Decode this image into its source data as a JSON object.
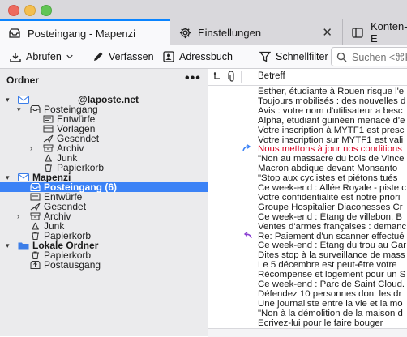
{
  "window": {
    "tabs": [
      {
        "label": "Posteingang - Mapenzi",
        "icon": "inbox-icon"
      },
      {
        "label": "Einstellungen",
        "icon": "gear-icon"
      },
      {
        "label": "Konten-E",
        "icon": "account-settings-icon"
      }
    ]
  },
  "toolbar": {
    "fetch_label": "Abrufen",
    "compose_label": "Verfassen",
    "addressbook_label": "Adressbuch",
    "quickfilter_label": "Schnellfilter",
    "search_placeholder": "Suchen <⌘K"
  },
  "sidebar": {
    "title": "Ordner",
    "menu": "•••",
    "folders": [
      {
        "label": "@laposte.net",
        "bold": true,
        "level": 0,
        "icon": "account-mail-icon",
        "twisty": "▾",
        "redacted": true
      },
      {
        "label": "Posteingang",
        "bold": false,
        "level": 1,
        "icon": "inbox-icon",
        "twisty": "▾"
      },
      {
        "label": "Entwürfe",
        "bold": false,
        "level": 2,
        "icon": "drafts-icon"
      },
      {
        "label": "Vorlagen",
        "bold": false,
        "level": 2,
        "icon": "templates-icon"
      },
      {
        "label": "Gesendet",
        "bold": false,
        "level": 2,
        "icon": "sent-icon"
      },
      {
        "label": "Archiv",
        "bold": false,
        "level": 2,
        "icon": "archive-icon",
        "twisty": "›"
      },
      {
        "label": "Junk",
        "bold": false,
        "level": 2,
        "icon": "junk-icon"
      },
      {
        "label": "Papierkorb",
        "bold": false,
        "level": 2,
        "icon": "trash-icon"
      },
      {
        "label": "Mapenzi",
        "bold": true,
        "level": 0,
        "icon": "account-mail-icon",
        "twisty": "▾"
      },
      {
        "label": "Posteingang (6)",
        "bold": true,
        "level": 1,
        "icon": "inbox-icon",
        "selected": true
      },
      {
        "label": "Entwürfe",
        "bold": false,
        "level": 1,
        "icon": "drafts-icon"
      },
      {
        "label": "Gesendet",
        "bold": false,
        "level": 1,
        "icon": "sent-icon"
      },
      {
        "label": "Archiv",
        "bold": false,
        "level": 1,
        "icon": "archive-icon",
        "twisty": "›"
      },
      {
        "label": "Junk",
        "bold": false,
        "level": 1,
        "icon": "junk-icon"
      },
      {
        "label": "Papierkorb",
        "bold": false,
        "level": 1,
        "icon": "trash-icon"
      },
      {
        "label": "Lokale Ordner",
        "bold": true,
        "level": 0,
        "icon": "local-folder-icon",
        "twisty": "▾"
      },
      {
        "label": "Papierkorb",
        "bold": false,
        "level": 1,
        "icon": "trash-icon"
      },
      {
        "label": "Postausgang",
        "bold": false,
        "level": 1,
        "icon": "outbox-icon"
      }
    ]
  },
  "message_list": {
    "header": {
      "subject_label": "Betreff"
    },
    "rows": [
      {
        "subject": "Esther, étudiante à Rouen risque l'e"
      },
      {
        "subject": "Toujours mobilisés : des nouvelles d"
      },
      {
        "subject": "Avis : votre nom d'utilisateur a besc"
      },
      {
        "subject": "Alpha, étudiant guinéen menacé d'e"
      },
      {
        "subject": "Votre inscription à MYTF1 est presc"
      },
      {
        "subject": "Votre inscription sur MYTF1 est vali"
      },
      {
        "subject": "Nous mettons à jour nos conditions",
        "red": true,
        "status": "forwarded"
      },
      {
        "subject": "\"Non au massacre du bois de Vince"
      },
      {
        "subject": "Macron abdique devant Monsanto"
      },
      {
        "subject": "\"Stop aux cyclistes et piétons tués"
      },
      {
        "subject": "Ce week-end : Allée Royale - piste c"
      },
      {
        "subject": "Votre confidentialité est notre priori"
      },
      {
        "subject": "Groupe Hospitalier Diaconesses Cr"
      },
      {
        "subject": "Ce week-end : Étang de  villebon, B"
      },
      {
        "subject": "Ventes d'armes françaises : demanc"
      },
      {
        "subject": "Re: Paiement d'un scanner effectué",
        "status": "replied"
      },
      {
        "subject": "Ce week-end : Étang du trou au Gar"
      },
      {
        "subject": "Dites stop à la surveillance de mass"
      },
      {
        "subject": "Le 5 décembre est peut-être votre"
      },
      {
        "subject": "Récompense et logement pour un S"
      },
      {
        "subject": "Ce week-end : Parc de Saint Cloud."
      },
      {
        "subject": "Défendez 10 personnes dont les dr"
      },
      {
        "subject": "Une journaliste entre la vie et la mo"
      },
      {
        "subject": "\"Non à la démolition de la maison d"
      },
      {
        "subject": "Ecrivez-lui pour le faire bouger"
      }
    ]
  },
  "colors": {
    "accent": "#0a84ff",
    "selection": "#3b82f6",
    "unread_red": "#d70022"
  }
}
